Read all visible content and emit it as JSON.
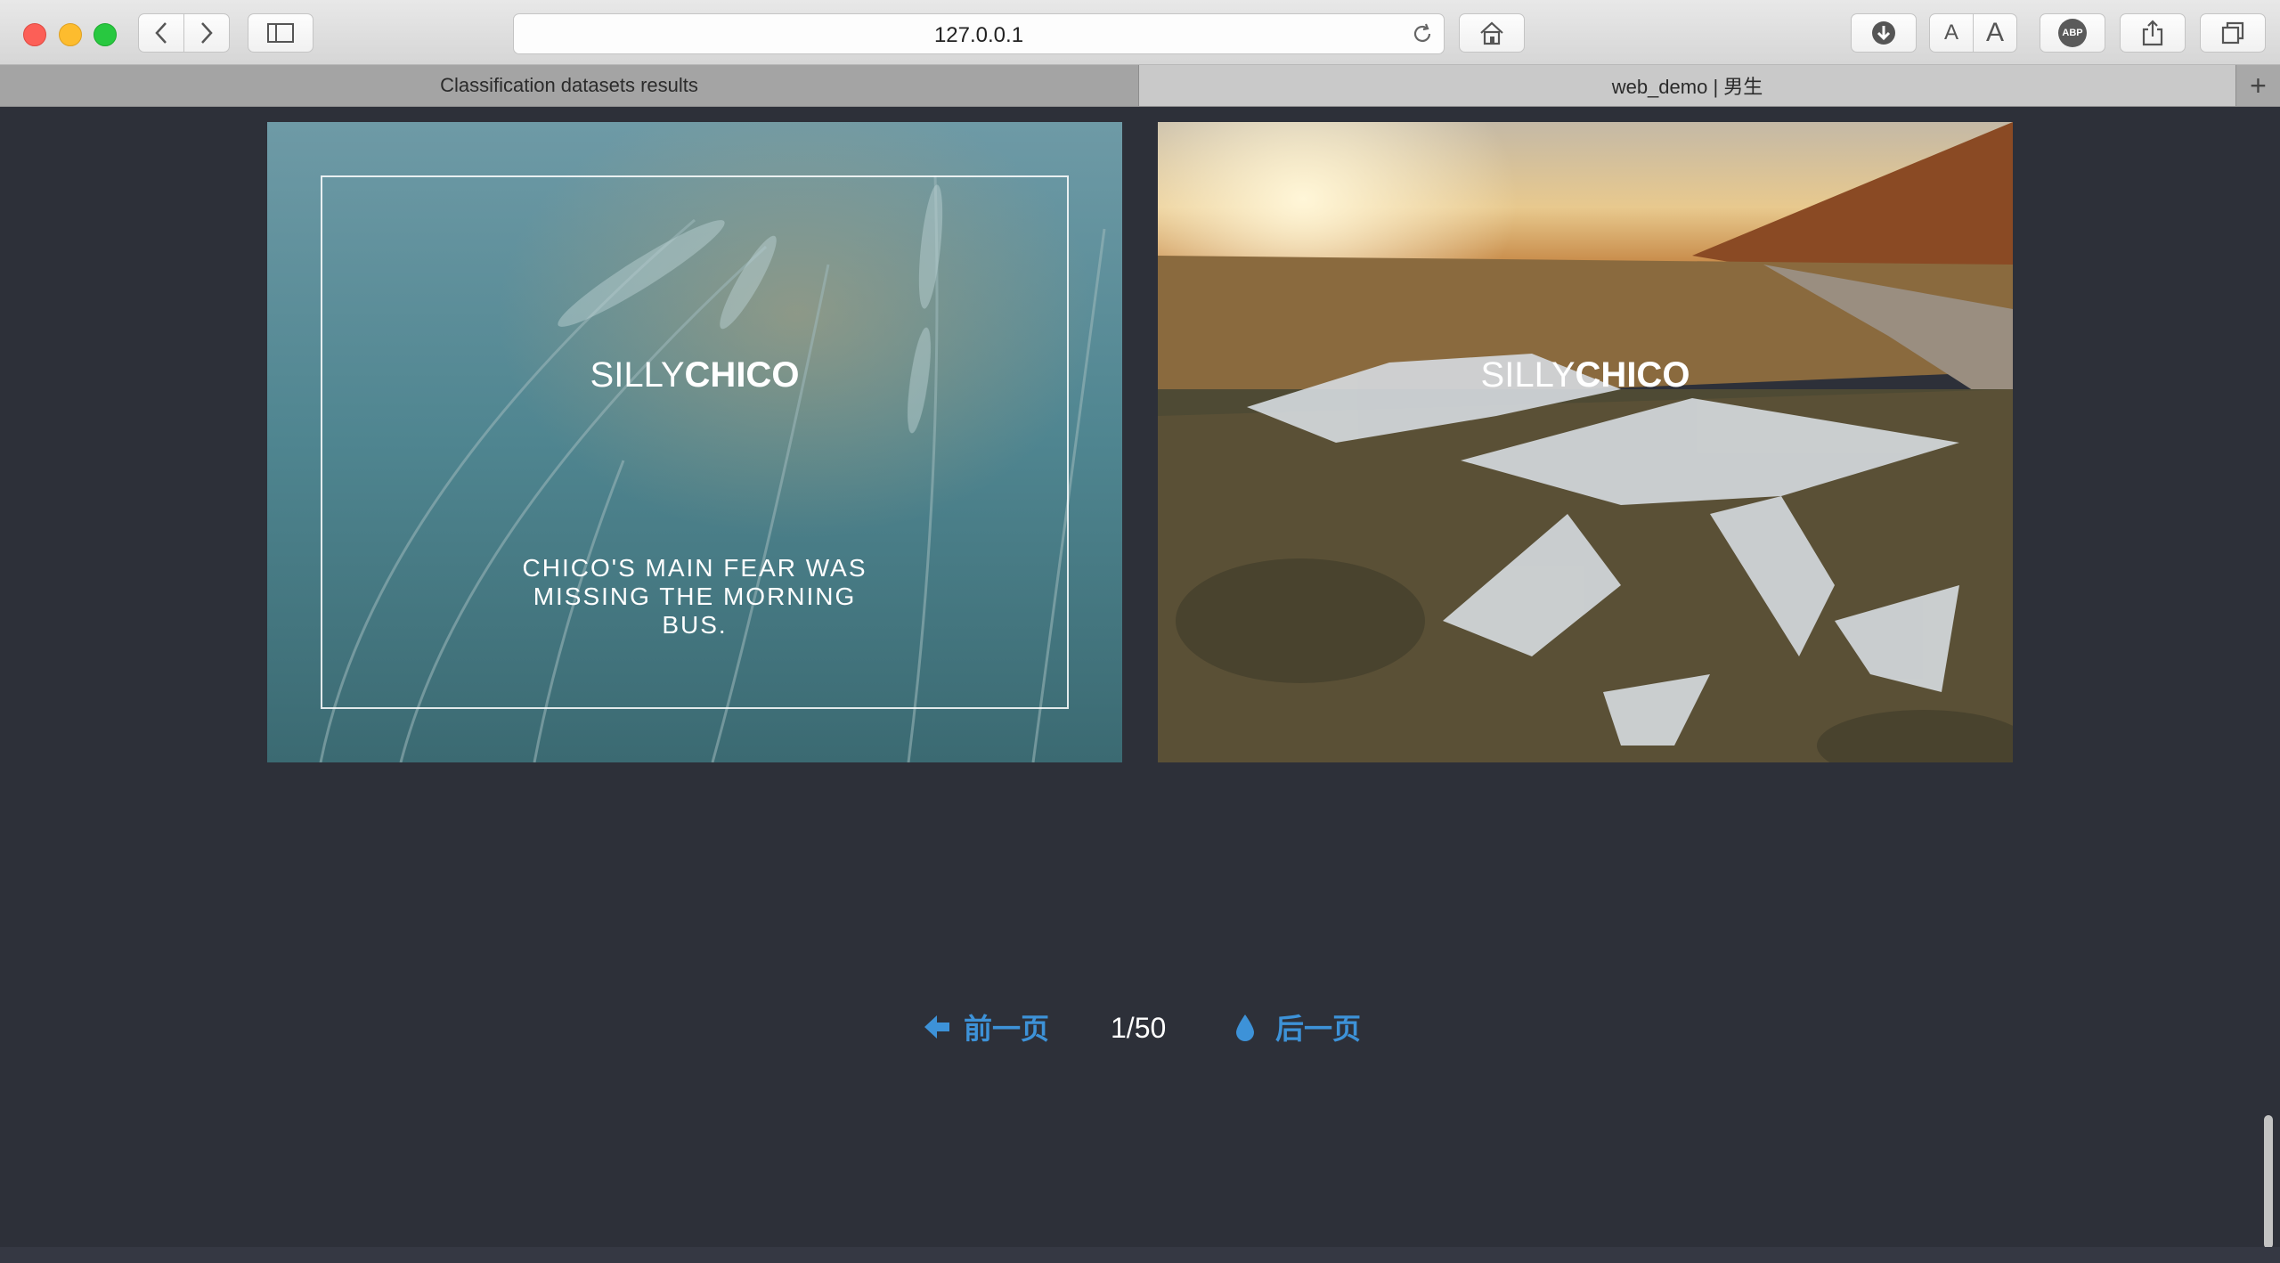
{
  "browser": {
    "url": "127.0.0.1",
    "tabs": [
      {
        "label": "Classification datasets results"
      },
      {
        "label": "web_demo | 男生"
      }
    ],
    "new_tab_label": "+",
    "reader_small_label": "A",
    "reader_large_label": "A",
    "adblock_label": "ABP"
  },
  "cards": [
    {
      "title_light": "SILLY",
      "title_bold": "CHICO",
      "description": "Chico's main fear was missing the morning bus."
    },
    {
      "title_light": "SILLY",
      "title_bold": "CHICO"
    }
  ],
  "pagination": {
    "prev_label": "前一页",
    "page_indicator": "1/50",
    "next_label": "后一页"
  },
  "colors": {
    "background": "#2d3039",
    "accent": "#3d92d8"
  }
}
